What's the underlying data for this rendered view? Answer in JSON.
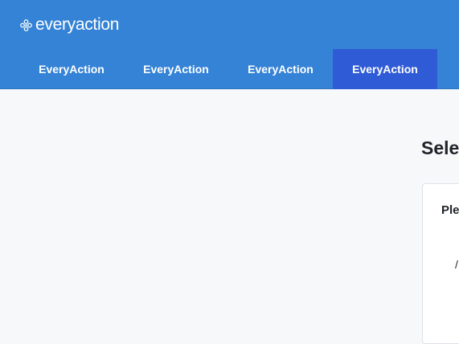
{
  "header": {
    "logo_text": "everyaction",
    "logo_icon": "flower-logo-icon",
    "tabs": [
      {
        "label": "EveryAction",
        "active": false
      },
      {
        "label": "EveryAction",
        "active": false
      },
      {
        "label": "EveryAction",
        "active": false
      },
      {
        "label": "EveryAction",
        "active": true
      }
    ]
  },
  "main": {
    "heading": "Sele",
    "card": {
      "heading": "Ple",
      "glyph": "/"
    }
  },
  "colors": {
    "header_bg": "#3583d6",
    "active_tab_bg": "#2f5bd6",
    "page_bg": "#f7f8fa"
  }
}
